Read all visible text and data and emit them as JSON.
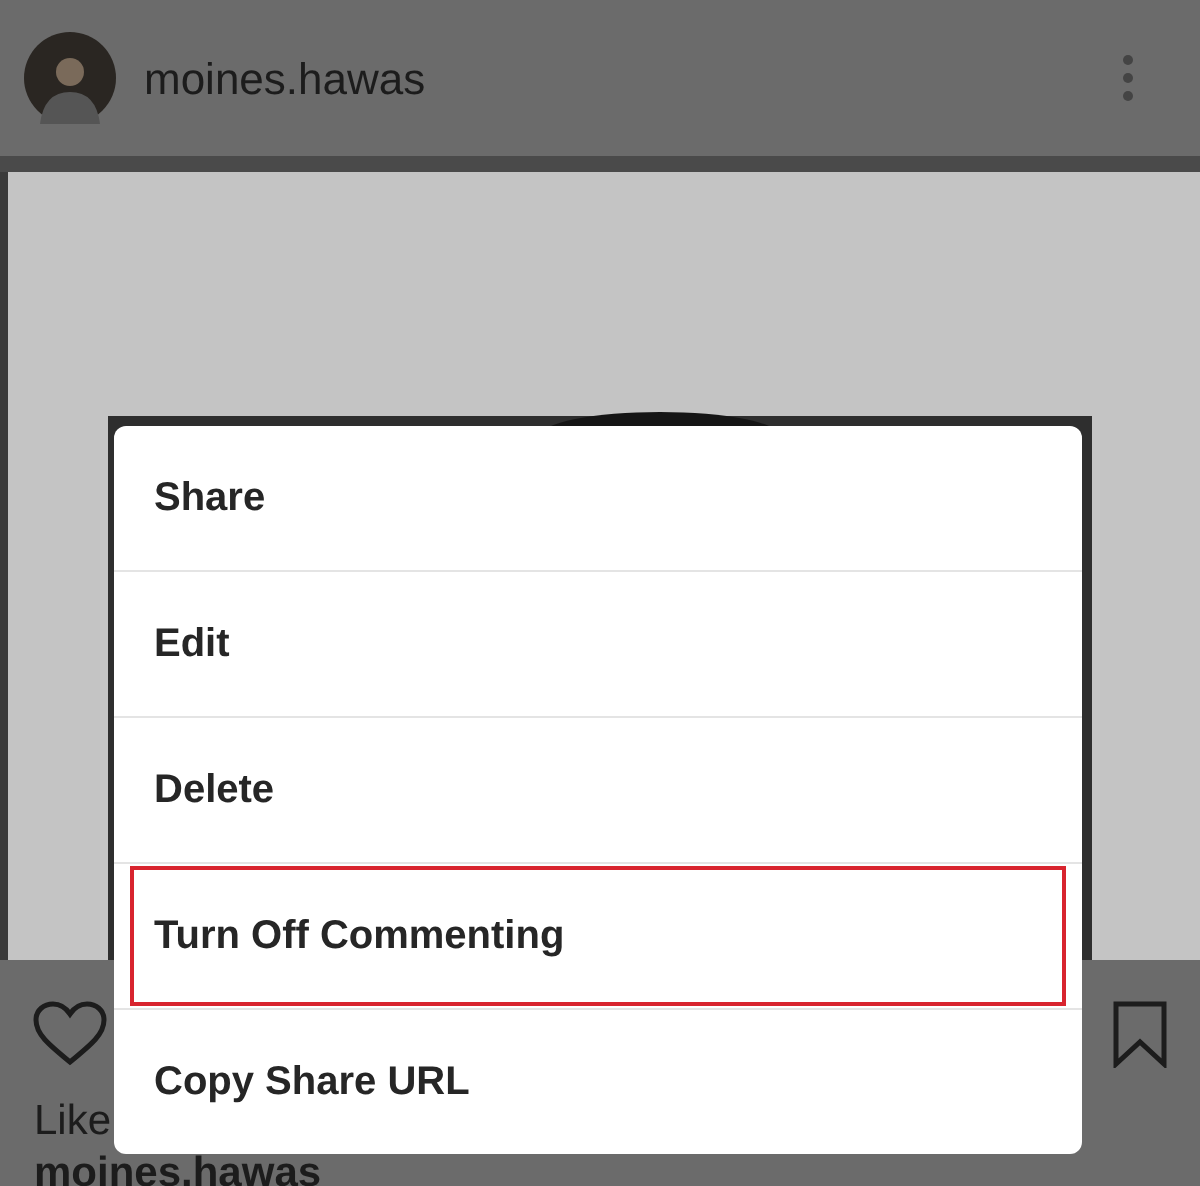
{
  "post": {
    "username": "moines.hawas",
    "likes_text": "Like",
    "caption_user": "moines.hawas"
  },
  "menu": {
    "items": [
      {
        "label": "Share",
        "highlighted": false
      },
      {
        "label": "Edit",
        "highlighted": false
      },
      {
        "label": "Delete",
        "highlighted": false
      },
      {
        "label": "Turn Off Commenting",
        "highlighted": true
      },
      {
        "label": "Copy Share URL",
        "highlighted": false
      }
    ]
  }
}
